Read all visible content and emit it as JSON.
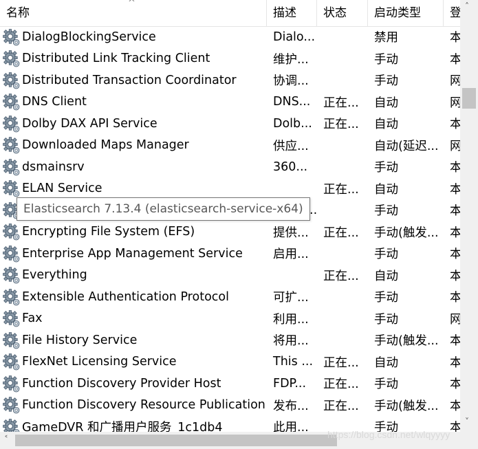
{
  "columns": {
    "name": "名称",
    "description": "描述",
    "status": "状态",
    "startup_type": "启动类型",
    "logon_as": "登"
  },
  "sort_indicator": "^",
  "rows": [
    {
      "name": "DialogBlockingService",
      "description": "Dialo...",
      "status": "",
      "startup_type": "禁用",
      "logon_as": "本"
    },
    {
      "name": "Distributed Link Tracking Client",
      "description": "维护...",
      "status": "",
      "startup_type": "手动",
      "logon_as": "本"
    },
    {
      "name": "Distributed Transaction Coordinator",
      "description": "协调...",
      "status": "",
      "startup_type": "手动",
      "logon_as": "网"
    },
    {
      "name": "DNS Client",
      "description": "DNS...",
      "status": "正在...",
      "startup_type": "自动",
      "logon_as": "网"
    },
    {
      "name": "Dolby DAX API Service",
      "description": "Dolb...",
      "status": "正在...",
      "startup_type": "自动",
      "logon_as": "本"
    },
    {
      "name": "Downloaded Maps Manager",
      "description": "供应...",
      "status": "",
      "startup_type": "自动(延迟...",
      "logon_as": "网"
    },
    {
      "name": "dsmainsrv",
      "description": "360...",
      "status": "",
      "startup_type": "手动",
      "logon_as": "本"
    },
    {
      "name": "ELAN Service",
      "description": "",
      "status": "正在...",
      "startup_type": "自动",
      "logon_as": "本"
    },
    {
      "name": "Elasticsearch 7.13.4 (elasticsearch-service-x64)",
      "description": "Elasti...",
      "status": "",
      "startup_type": "手动",
      "logon_as": "本"
    },
    {
      "name": "Encrypting File System (EFS)",
      "description": "提供...",
      "status": "正在...",
      "startup_type": "手动(触发...",
      "logon_as": "本"
    },
    {
      "name": "Enterprise App Management Service",
      "description": "启用...",
      "status": "",
      "startup_type": "手动",
      "logon_as": "本"
    },
    {
      "name": "Everything",
      "description": "",
      "status": "正在...",
      "startup_type": "自动",
      "logon_as": "本"
    },
    {
      "name": "Extensible Authentication Protocol",
      "description": "可扩...",
      "status": "",
      "startup_type": "手动",
      "logon_as": "本"
    },
    {
      "name": "Fax",
      "description": "利用...",
      "status": "",
      "startup_type": "手动",
      "logon_as": "网"
    },
    {
      "name": "File History Service",
      "description": "将用...",
      "status": "",
      "startup_type": "手动(触发...",
      "logon_as": "本"
    },
    {
      "name": "FlexNet Licensing Service",
      "description": "This ...",
      "status": "正在...",
      "startup_type": "自动",
      "logon_as": "本"
    },
    {
      "name": "Function Discovery Provider Host",
      "description": "FDP...",
      "status": "正在...",
      "startup_type": "手动",
      "logon_as": "本"
    },
    {
      "name": "Function Discovery Resource Publication",
      "description": "发布...",
      "status": "正在...",
      "startup_type": "手动(触发...",
      "logon_as": "本"
    },
    {
      "name": "GameDVR 和广播用户服务_1c1db4",
      "description": "此用...",
      "status": "",
      "startup_type": "手动",
      "logon_as": "本"
    }
  ],
  "row_icon": "service-gear-icon",
  "tooltip": "Elasticsearch 7.13.4 (elasticsearch-service-x64)",
  "watermark": "https://blog.csdn.net/wlqyyyy"
}
